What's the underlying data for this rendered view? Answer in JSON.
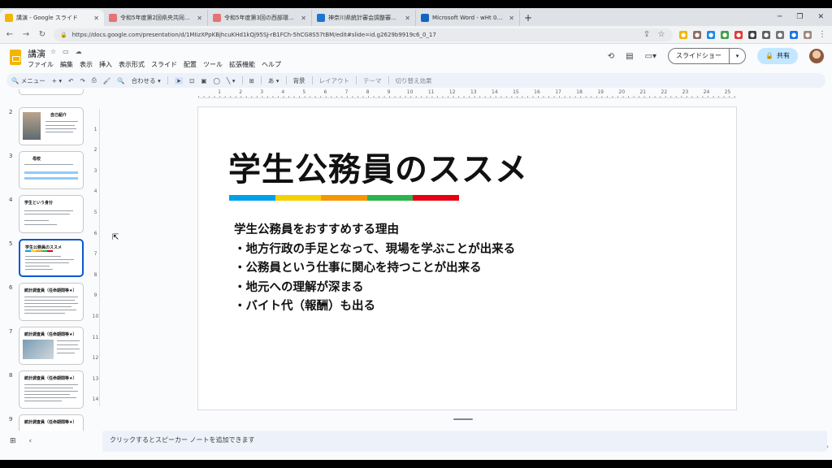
{
  "browser": {
    "tabs": [
      {
        "title": "講演 - Google スライド",
        "color": "#f4b400",
        "active": true
      },
      {
        "title": "令和5年度第2回県央共同事業推",
        "color": "#e57373",
        "active": false
      },
      {
        "title": "令和5年度第3回の西部環境推進",
        "color": "#e57373",
        "active": false
      },
      {
        "title": "神奈川県統計審会調整審議会の",
        "color": "#1976d2",
        "active": false
      },
      {
        "title": "Microsoft Word - wHt 01_ep'g%",
        "color": "#1565c0",
        "active": false
      }
    ],
    "new_tab": "+",
    "window_controls": {
      "minimize": "─",
      "restore": "❐",
      "close": "✕"
    },
    "url": "https://docs.google.com/presentation/d/1MIizXPpKBjhcuKHd1kQj95SJ-rB1FCh-5hCG8S57tBM/edit#slide=id.g2629b9919c6_0_17"
  },
  "app": {
    "doc_title": "講演",
    "menu": [
      "ファイル",
      "編集",
      "表示",
      "挿入",
      "表示形式",
      "スライド",
      "配置",
      "ツール",
      "拡張機能",
      "ヘルプ"
    ],
    "slideshow_label": "スライドショー",
    "share_label": "共有",
    "brand_color": "#f4b400"
  },
  "toolbar": {
    "menu_search": "メニュー",
    "zoom": "合わせる",
    "background": "背景",
    "layout": "レイアウト",
    "theme": "テーマ",
    "transition": "切り替え効果"
  },
  "filmstrip": {
    "slides": [
      {
        "num": "2",
        "title": "自己紹介"
      },
      {
        "num": "3",
        "title": "母校"
      },
      {
        "num": "4",
        "title": "学生という身分"
      },
      {
        "num": "5",
        "title": "学生公務員のススメ",
        "selected": true
      },
      {
        "num": "6",
        "title": "統計調査員（任命期間等★）"
      },
      {
        "num": "7",
        "title": "統計調査員（任命期間等★）"
      },
      {
        "num": "8",
        "title": "統計調査員（任命期間等★）"
      },
      {
        "num": "9",
        "title": "統計調査員（任命期間等★）"
      }
    ]
  },
  "ruler": {
    "h_ticks": [
      "1",
      "2",
      "3",
      "4",
      "5",
      "6",
      "7",
      "8",
      "9",
      "10",
      "11",
      "12",
      "13",
      "14",
      "15",
      "16",
      "17",
      "18",
      "19",
      "20",
      "21",
      "22",
      "23",
      "24",
      "25"
    ],
    "v_ticks": [
      "1",
      "2",
      "3",
      "4",
      "5",
      "6",
      "7",
      "8",
      "9",
      "10",
      "11",
      "12",
      "13",
      "14"
    ]
  },
  "slide": {
    "title": "学生公務員のススメ",
    "color_bar": [
      "#00a0e9",
      "#f5d100",
      "#f39800",
      "#2db34a",
      "#e60012"
    ],
    "body_heading": "学生公務員をおすすめする理由",
    "bullets": [
      "・地方行政の手足となって、現場を学ぶことが出来る",
      "・公務員という仕事に関心を持つことが出来る",
      "・地元への理解が深まる",
      "・バイト代（報酬）も出る"
    ]
  },
  "notes": {
    "placeholder": "クリックするとスピーカー ノートを追加できます"
  }
}
